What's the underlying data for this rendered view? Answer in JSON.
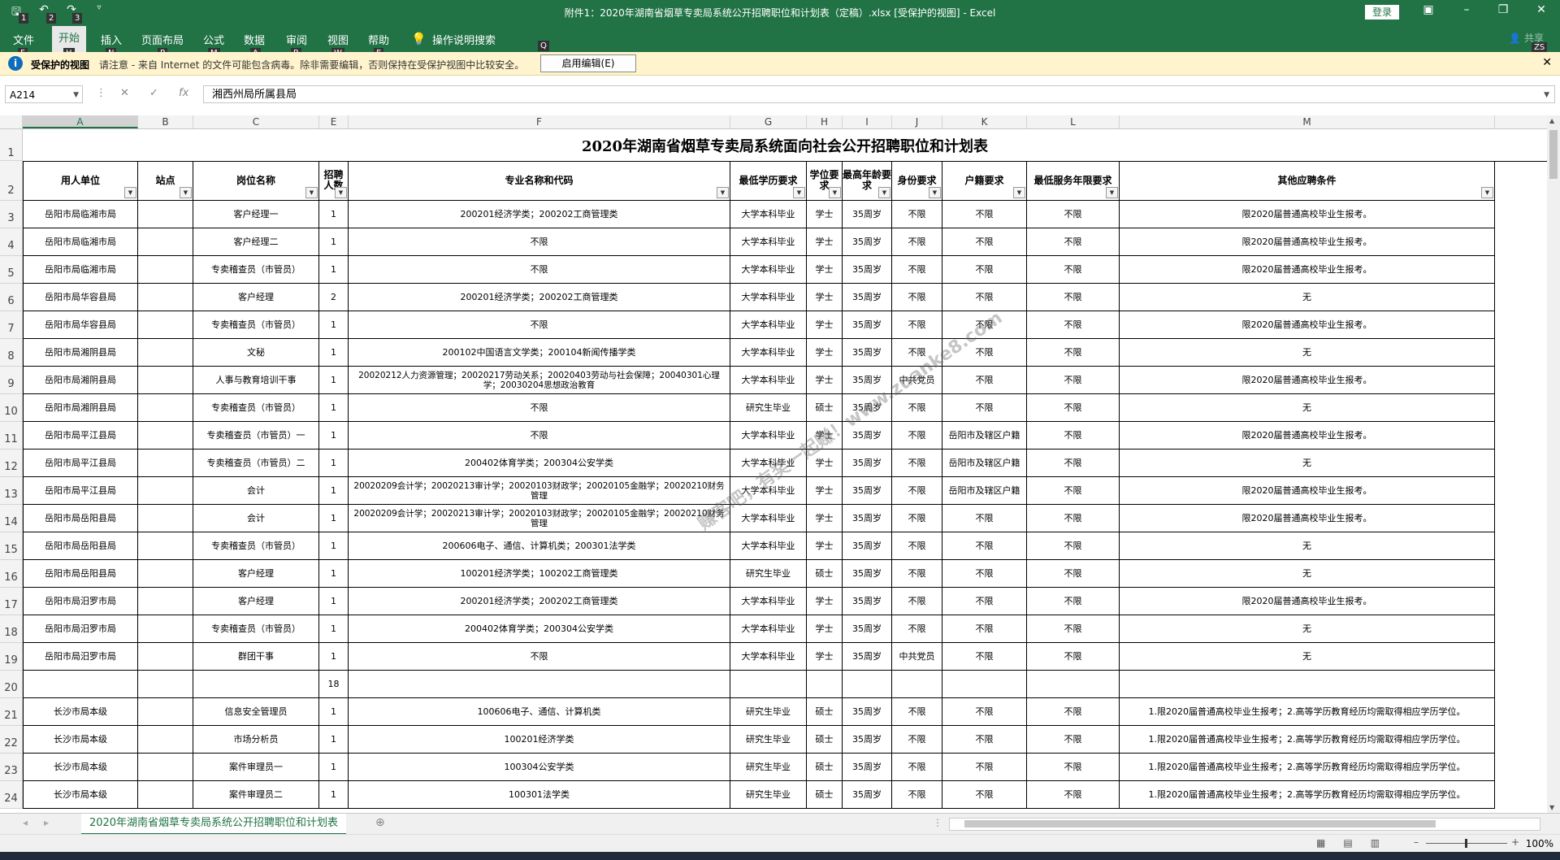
{
  "window": {
    "title": "附件1：2020年湖南省烟草专卖局系统公开招聘职位和计划表（定稿）.xlsx  [受保护的视图]  -  Excel",
    "login": "登录",
    "qat_icons": [
      "save-icon",
      "undo-icon",
      "redo-icon",
      "customize-icon"
    ],
    "qat_tips": [
      "1",
      "2",
      "3"
    ]
  },
  "ribbon": {
    "tabs": [
      {
        "label": "文件",
        "tip": "F"
      },
      {
        "label": "开始",
        "tip": "H"
      },
      {
        "label": "插入",
        "tip": "N"
      },
      {
        "label": "页面布局",
        "tip": "P"
      },
      {
        "label": "公式",
        "tip": "M"
      },
      {
        "label": "数据",
        "tip": "A"
      },
      {
        "label": "审阅",
        "tip": "R"
      },
      {
        "label": "视图",
        "tip": "W"
      },
      {
        "label": "帮助",
        "tip": "E"
      },
      {
        "label": "操作说明搜索",
        "tip": "Q"
      }
    ],
    "share": "共享",
    "share_tip": "ZS"
  },
  "protected": {
    "label": "受保护的视图",
    "message": "请注意 - 来自 Internet 的文件可能包含病毒。除非需要编辑，否则保持在受保护视图中比较安全。",
    "button": "启用编辑(E)"
  },
  "formula": {
    "namebox": "A214",
    "content": "湘西州局所属县局"
  },
  "grid": {
    "columns": [
      "A",
      "B",
      "C",
      "E",
      "F",
      "G",
      "H",
      "I",
      "J",
      "K",
      "L",
      "M"
    ],
    "title": "2020年湖南省烟草专卖局系统面向社会公开招聘职位和计划表",
    "headers": [
      "用人单位",
      "站点",
      "岗位名称",
      "招聘人数",
      "专业名称和代码",
      "最低学历要求",
      "学位要求",
      "最高年龄要求",
      "身份要求",
      "户籍要求",
      "最低服务年限要求",
      "其他应聘条件"
    ],
    "rows": [
      [
        "3",
        "岳阳市局临湘市局",
        "",
        "客户经理一",
        "1",
        "200201经济学类；200202工商管理类",
        "大学本科毕业",
        "学士",
        "35周岁",
        "不限",
        "不限",
        "不限",
        "限2020届普通高校毕业生报考。"
      ],
      [
        "4",
        "岳阳市局临湘市局",
        "",
        "客户经理二",
        "1",
        "不限",
        "大学本科毕业",
        "学士",
        "35周岁",
        "不限",
        "不限",
        "不限",
        "限2020届普通高校毕业生报考。"
      ],
      [
        "5",
        "岳阳市局临湘市局",
        "",
        "专卖稽查员（市管员）",
        "1",
        "不限",
        "大学本科毕业",
        "学士",
        "35周岁",
        "不限",
        "不限",
        "不限",
        "限2020届普通高校毕业生报考。"
      ],
      [
        "6",
        "岳阳市局华容县局",
        "",
        "客户经理",
        "2",
        "200201经济学类；200202工商管理类",
        "大学本科毕业",
        "学士",
        "35周岁",
        "不限",
        "不限",
        "不限",
        "无"
      ],
      [
        "7",
        "岳阳市局华容县局",
        "",
        "专卖稽查员（市管员）",
        "1",
        "不限",
        "大学本科毕业",
        "学士",
        "35周岁",
        "不限",
        "不限",
        "不限",
        "限2020届普通高校毕业生报考。"
      ],
      [
        "8",
        "岳阳市局湘阴县局",
        "",
        "文秘",
        "1",
        "200102中国语言文学类；200104新闻传播学类",
        "大学本科毕业",
        "学士",
        "35周岁",
        "不限",
        "不限",
        "不限",
        "无"
      ],
      [
        "9",
        "岳阳市局湘阴县局",
        "",
        "人事与教育培训干事",
        "1",
        "20020212人力资源管理；20020217劳动关系；20020403劳动与社会保障；20040301心理学；20030204思想政治教育",
        "大学本科毕业",
        "学士",
        "35周岁",
        "中共党员",
        "不限",
        "不限",
        "限2020届普通高校毕业生报考。"
      ],
      [
        "10",
        "岳阳市局湘阴县局",
        "",
        "专卖稽查员（市管员）",
        "1",
        "不限",
        "研究生毕业",
        "硕士",
        "35周岁",
        "不限",
        "不限",
        "不限",
        "无"
      ],
      [
        "11",
        "岳阳市局平江县局",
        "",
        "专卖稽查员（市管员）一",
        "1",
        "不限",
        "大学本科毕业",
        "学士",
        "35周岁",
        "不限",
        "岳阳市及辖区户籍",
        "不限",
        "限2020届普通高校毕业生报考。"
      ],
      [
        "12",
        "岳阳市局平江县局",
        "",
        "专卖稽查员（市管员）二",
        "1",
        "200402体育学类；200304公安学类",
        "大学本科毕业",
        "学士",
        "35周岁",
        "不限",
        "岳阳市及辖区户籍",
        "不限",
        "无"
      ],
      [
        "13",
        "岳阳市局平江县局",
        "",
        "会计",
        "1",
        "20020209会计学；20020213审计学；20020103财政学；20020105金融学；20020210财务管理",
        "大学本科毕业",
        "学士",
        "35周岁",
        "不限",
        "岳阳市及辖区户籍",
        "不限",
        "限2020届普通高校毕业生报考。"
      ],
      [
        "14",
        "岳阳市局岳阳县局",
        "",
        "会计",
        "1",
        "20020209会计学；20020213审计学；20020103财政学；20020105金融学；20020210财务管理",
        "大学本科毕业",
        "学士",
        "35周岁",
        "不限",
        "不限",
        "不限",
        "限2020届普通高校毕业生报考。"
      ],
      [
        "15",
        "岳阳市局岳阳县局",
        "",
        "专卖稽查员（市管员）",
        "1",
        "200606电子、通信、计算机类；200301法学类",
        "大学本科毕业",
        "学士",
        "35周岁",
        "不限",
        "不限",
        "不限",
        "无"
      ],
      [
        "16",
        "岳阳市局岳阳县局",
        "",
        "客户经理",
        "1",
        "100201经济学类；100202工商管理类",
        "研究生毕业",
        "硕士",
        "35周岁",
        "不限",
        "不限",
        "不限",
        "无"
      ],
      [
        "17",
        "岳阳市局汨罗市局",
        "",
        "客户经理",
        "1",
        "200201经济学类；200202工商管理类",
        "大学本科毕业",
        "学士",
        "35周岁",
        "不限",
        "不限",
        "不限",
        "限2020届普通高校毕业生报考。"
      ],
      [
        "18",
        "岳阳市局汨罗市局",
        "",
        "专卖稽查员（市管员）",
        "1",
        "200402体育学类；200304公安学类",
        "大学本科毕业",
        "学士",
        "35周岁",
        "不限",
        "不限",
        "不限",
        "无"
      ],
      [
        "19",
        "岳阳市局汨罗市局",
        "",
        "群团干事",
        "1",
        "不限",
        "大学本科毕业",
        "学士",
        "35周岁",
        "中共党员",
        "不限",
        "不限",
        "无"
      ],
      [
        "20",
        "",
        "",
        "",
        "18",
        "",
        "",
        "",
        "",
        "",
        "",
        "",
        ""
      ],
      [
        "21",
        "长沙市局本级",
        "",
        "信息安全管理员",
        "1",
        "100606电子、通信、计算机类",
        "研究生毕业",
        "硕士",
        "35周岁",
        "不限",
        "不限",
        "不限",
        "1.限2020届普通高校毕业生报考；2.高等学历教育经历均需取得相应学历学位。"
      ],
      [
        "22",
        "长沙市局本级",
        "",
        "市场分析员",
        "1",
        "100201经济学类",
        "研究生毕业",
        "硕士",
        "35周岁",
        "不限",
        "不限",
        "不限",
        "1.限2020届普通高校毕业生报考；2.高等学历教育经历均需取得相应学历学位。"
      ],
      [
        "23",
        "长沙市局本级",
        "",
        "案件审理员一",
        "1",
        "100304公安学类",
        "研究生毕业",
        "硕士",
        "35周岁",
        "不限",
        "不限",
        "不限",
        "1.限2020届普通高校毕业生报考；2.高等学历教育经历均需取得相应学历学位。"
      ],
      [
        "24",
        "长沙市局本级",
        "",
        "案件审理员二",
        "1",
        "100301法学类",
        "研究生毕业",
        "硕士",
        "35周岁",
        "不限",
        "不限",
        "不限",
        "1.限2020届普通高校毕业生报考；2.高等学历教育经历均需取得相应学历学位。"
      ]
    ]
  },
  "watermark": "赚客吧，有奖一起赚！www.zuanke8.com",
  "sheet": {
    "tab": "2020年湖南省烟草专卖局系统公开招聘职位和计划表"
  },
  "status": {
    "zoom": "100%"
  }
}
